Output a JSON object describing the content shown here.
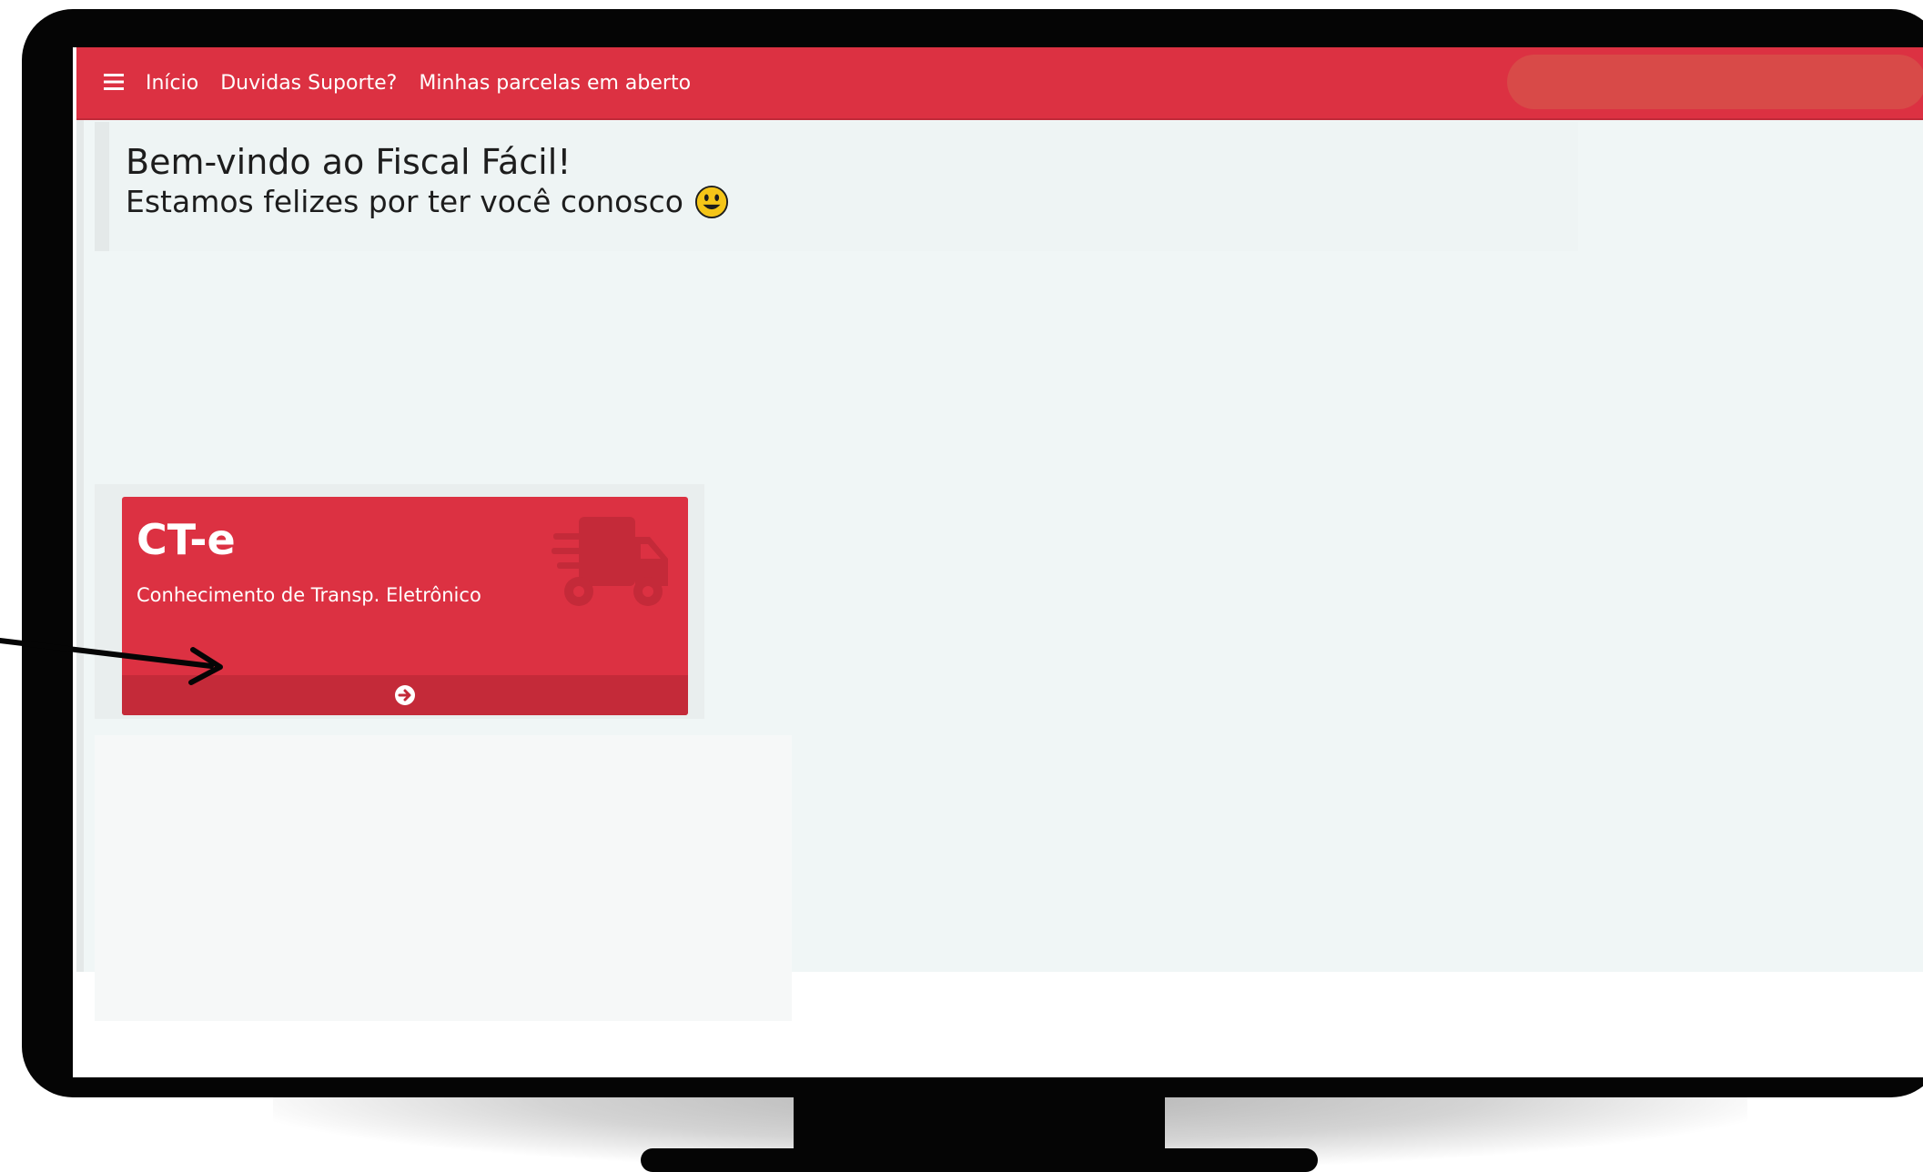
{
  "navbar": {
    "menu_icon": "hamburger-icon",
    "links": [
      {
        "label": "Início"
      },
      {
        "label": "Duvidas Suporte?"
      },
      {
        "label": "Minhas parcelas em aberto"
      }
    ]
  },
  "welcome": {
    "title": "Bem-vindo ao Fiscal Fácil!",
    "subtitle": "Estamos felizes por ter você conosco",
    "emoji_icon": "smiley-icon"
  },
  "card": {
    "title": "CT-e",
    "description": "Conhecimento de Transp. Eletrônico",
    "icon": "truck-icon",
    "footer_icon": "arrow-circle-right-icon"
  },
  "colors": {
    "primary": "#dc3142",
    "primary_dark": "#c42a39",
    "background": "#f0f6f6",
    "bezel": "#050505"
  }
}
